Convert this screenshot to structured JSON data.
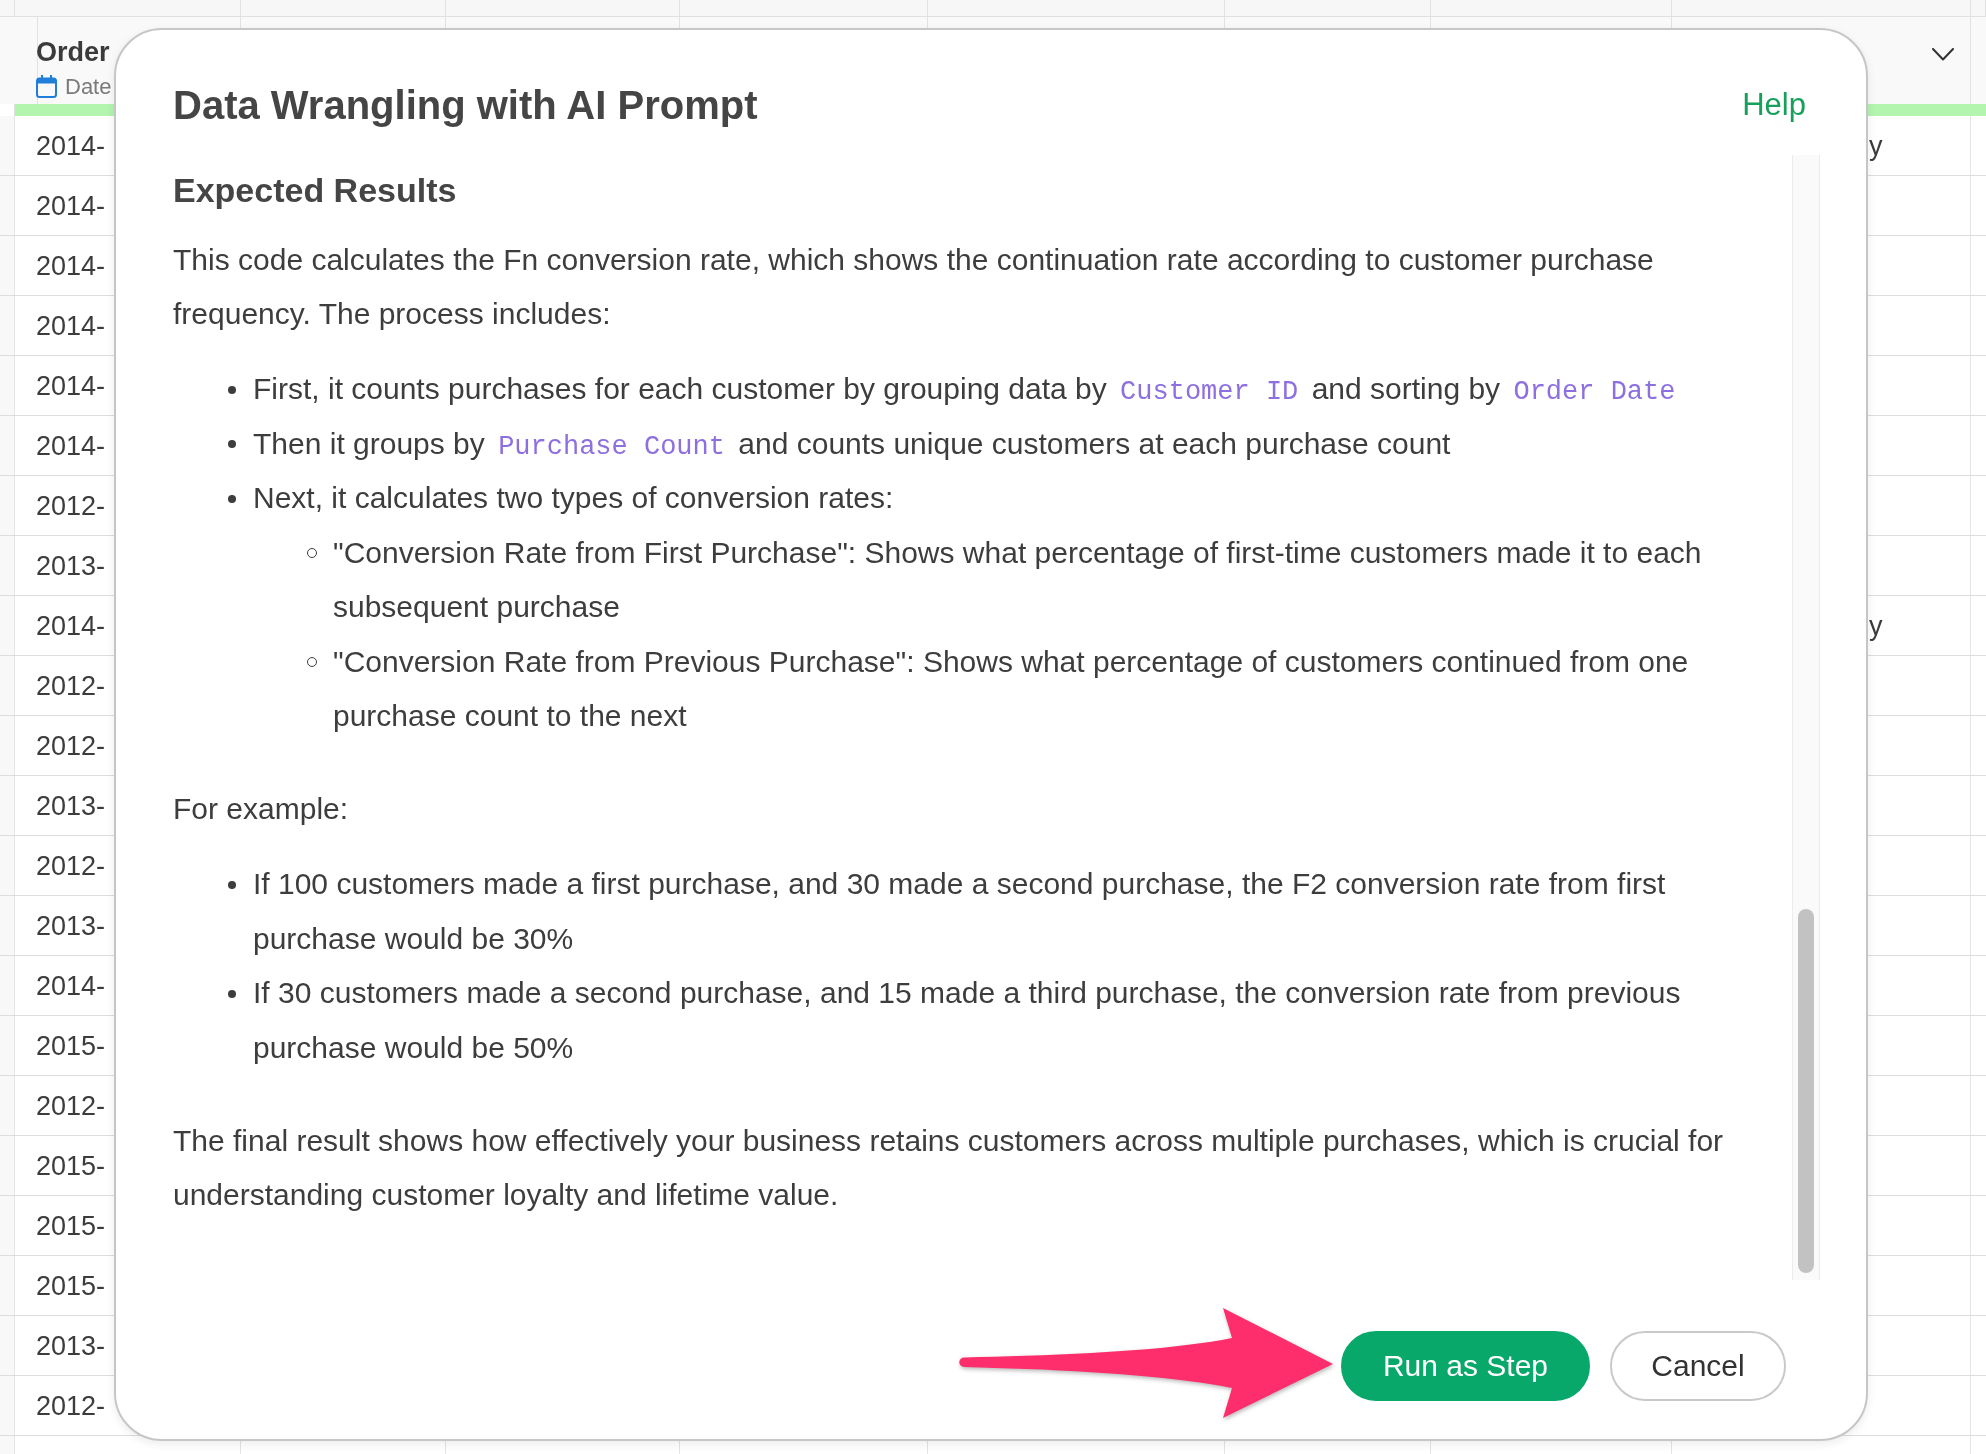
{
  "table": {
    "header": {
      "title": "Order",
      "type": "Date"
    },
    "rows": [
      {
        "order": "2014-",
        "column_2": "y"
      },
      {
        "order": "2014-"
      },
      {
        "order": "2014-"
      },
      {
        "order": "2014-"
      },
      {
        "order": "2014-"
      },
      {
        "order": "2014-"
      },
      {
        "order": "2012-"
      },
      {
        "order": "2013-"
      },
      {
        "order": "2014-",
        "column_2": "y"
      },
      {
        "order": "2012-"
      },
      {
        "order": "2012-"
      },
      {
        "order": "2013-"
      },
      {
        "order": "2012-"
      },
      {
        "order": "2013-"
      },
      {
        "order": "2014-"
      },
      {
        "order": "2015-"
      },
      {
        "order": "2012-"
      },
      {
        "order": "2015-"
      },
      {
        "order": "2015-"
      },
      {
        "order": "2015-"
      },
      {
        "order": "2013-"
      },
      {
        "order": "2012-"
      }
    ]
  },
  "dialog": {
    "title": "Data Wrangling with AI Prompt",
    "help_link": "Help",
    "content": [
      {
        "kind": "heading",
        "text": "Expected Results"
      },
      {
        "kind": "paragraph",
        "text": "This code calculates the Fn conversion rate, which shows the continuation rate according to customer purchase frequency. The process includes:"
      },
      {
        "kind": "list",
        "items": [
          {
            "parts": [
              {
                "kind": "text",
                "text": "First, it counts purchases for each customer by grouping data by "
              },
              {
                "kind": "code",
                "text": "Customer ID"
              },
              {
                "kind": "text",
                "text": " and sorting by "
              },
              {
                "kind": "code",
                "text": "Order Date"
              }
            ]
          },
          {
            "parts": [
              {
                "kind": "text",
                "text": "Then it groups by "
              },
              {
                "kind": "code",
                "text": "Purchase Count"
              },
              {
                "kind": "text",
                "text": " and counts unique customers at each purchase count"
              }
            ]
          },
          {
            "parts": [
              {
                "kind": "text",
                "text": "Next, it calculates two types of conversion rates:"
              }
            ],
            "children": [
              {
                "parts": [
                  {
                    "kind": "text",
                    "text": "\"Conversion Rate from First Purchase\": Shows what percentage of first-time customers made it to each subsequent purchase"
                  }
                ]
              },
              {
                "parts": [
                  {
                    "kind": "text",
                    "text": "\"Conversion Rate from Previous Purchase\": Shows what percentage of customers continued from one purchase count to the next"
                  }
                ]
              }
            ]
          }
        ]
      },
      {
        "kind": "paragraph",
        "text": "For example:"
      },
      {
        "kind": "list",
        "items": [
          {
            "parts": [
              {
                "kind": "text",
                "text": "If 100 customers made a first purchase, and 30 made a second purchase, the F2 conversion rate from first purchase would be 30%"
              }
            ]
          },
          {
            "parts": [
              {
                "kind": "text",
                "text": "If 30 customers made a second purchase, and 15 made a third purchase, the conversion rate from previous purchase would be 50%"
              }
            ]
          }
        ]
      },
      {
        "kind": "paragraph",
        "text": "The final result shows how effectively your business retains customers across multiple purchases, which is crucial for understanding customer loyalty and lifetime value."
      }
    ],
    "buttons": [
      {
        "label": "Run as Step",
        "kind": "primary"
      },
      {
        "label": "Cancel",
        "kind": "secondary"
      }
    ]
  }
}
